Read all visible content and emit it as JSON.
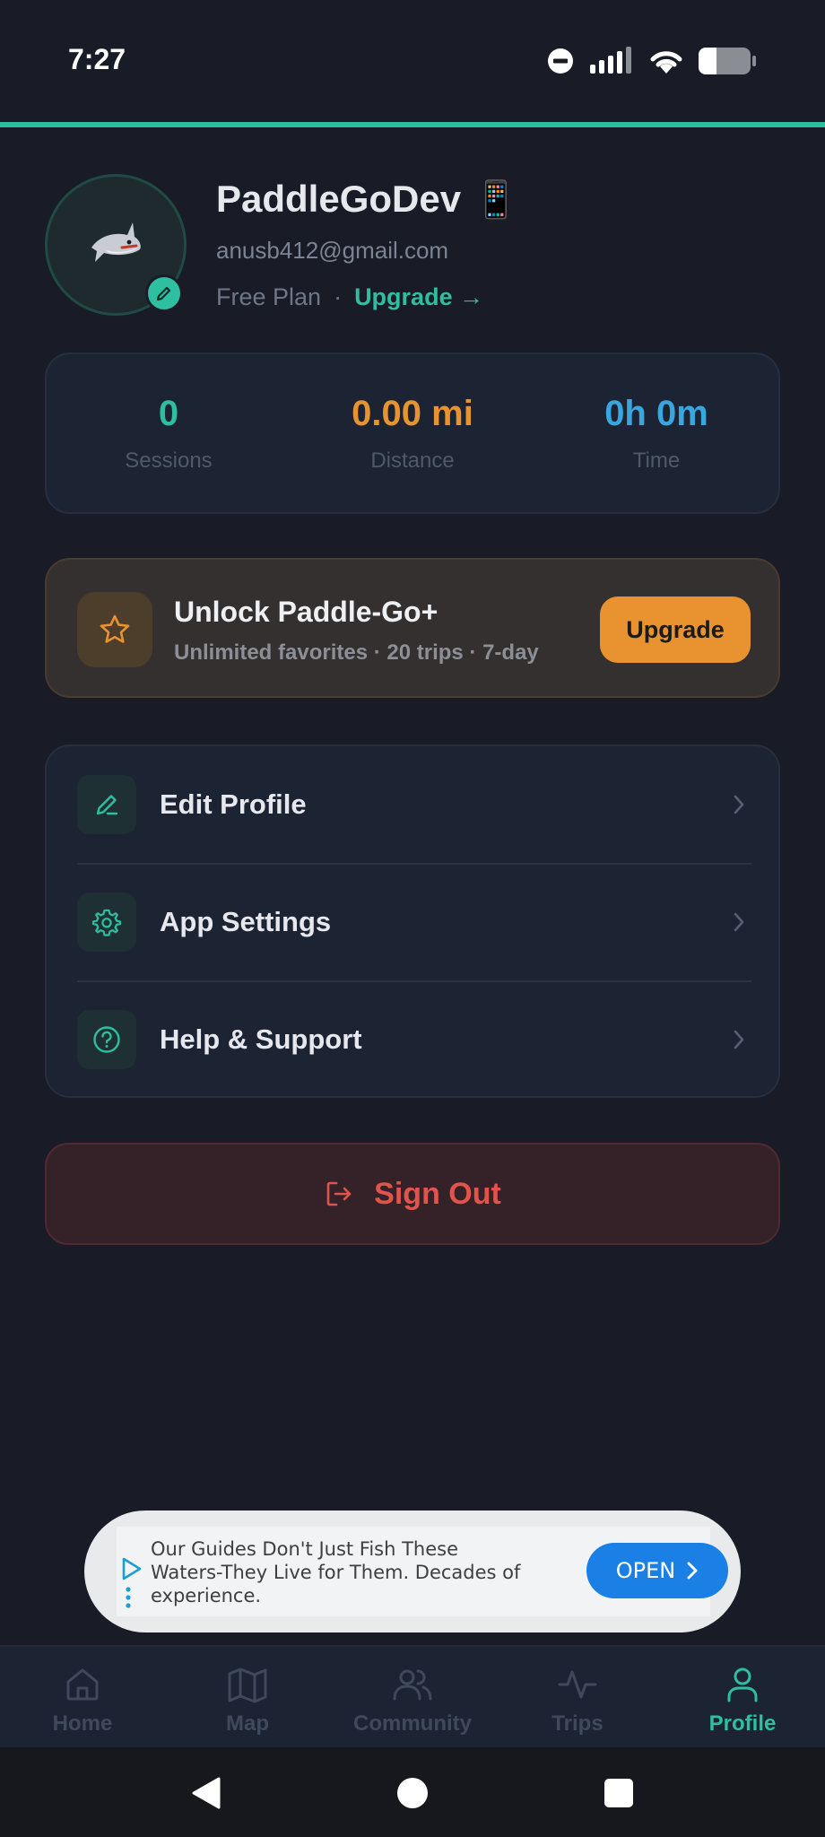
{
  "status_bar": {
    "time": "7:27"
  },
  "profile": {
    "name": "PaddleGoDev",
    "name_emoji": "📱",
    "email": "anusb412@gmail.com",
    "plan": "Free Plan",
    "separator": "·",
    "upgrade_link": "Upgrade →",
    "avatar_icon": "shark-icon"
  },
  "stats": [
    {
      "value": "0",
      "label": "Sessions",
      "color": "#2dbf9f"
    },
    {
      "value": "0.00 mi",
      "label": "Distance",
      "color": "#e8932f"
    },
    {
      "value": "0h 0m",
      "label": "Time",
      "color": "#3aa6e0"
    }
  ],
  "promo": {
    "title": "Unlock Paddle-Go+",
    "subtitle": "Unlimited favorites · 20 trips · 7-day",
    "button": "Upgrade",
    "icon": "star-icon"
  },
  "menu": [
    {
      "label": "Edit Profile",
      "icon": "pencil-icon"
    },
    {
      "label": "App Settings",
      "icon": "gear-icon"
    },
    {
      "label": "Help & Support",
      "icon": "help-circle-icon"
    }
  ],
  "sign_out": {
    "label": "Sign Out",
    "icon": "logout-icon"
  },
  "ad": {
    "text": "Our Guides Don't Just Fish These Waters-They Live for Them. Decades of experience.",
    "button": "OPEN"
  },
  "bottom_nav": [
    {
      "label": "Home",
      "icon": "home-icon",
      "active": false
    },
    {
      "label": "Map",
      "icon": "map-icon",
      "active": false
    },
    {
      "label": "Community",
      "icon": "users-icon",
      "active": false
    },
    {
      "label": "Trips",
      "icon": "activity-icon",
      "active": false
    },
    {
      "label": "Profile",
      "icon": "user-icon",
      "active": true
    }
  ],
  "colors": {
    "accent": "#2dbf9f",
    "warning": "#e8932f",
    "danger": "#e0544c",
    "background": "#191b27"
  }
}
